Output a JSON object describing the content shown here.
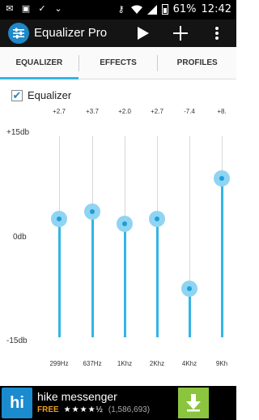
{
  "status_bar": {
    "battery": "61%",
    "time": "12:42",
    "left_icons": [
      "mail-icon",
      "image-icon",
      "shield-check-icon",
      "chevron-down-icon"
    ],
    "right_icons": [
      "key-icon",
      "wifi-icon",
      "signal-icon",
      "battery-icon"
    ]
  },
  "app_bar": {
    "title": "Equalizer Pro",
    "actions": [
      "play-icon",
      "add-icon",
      "overflow-menu-icon"
    ]
  },
  "tabs": [
    {
      "label": "EQUALIZER",
      "active": true
    },
    {
      "label": "EFFECTS",
      "active": false
    },
    {
      "label": "PROFILES",
      "active": false
    }
  ],
  "equalizer": {
    "toggle_label": "Equalizer",
    "enabled": true,
    "db_max_label": "+15db",
    "db_mid_label": "0db",
    "db_min_label": "-15db",
    "range": [
      -15,
      15
    ],
    "bands": [
      {
        "freq": "299Hz",
        "value_label": "+2.7",
        "value": 2.7
      },
      {
        "freq": "637Hz",
        "value_label": "+3.7",
        "value": 3.7
      },
      {
        "freq": "1Khz",
        "value_label": "+2.0",
        "value": 2.0
      },
      {
        "freq": "2Khz",
        "value_label": "+2.7",
        "value": 2.7
      },
      {
        "freq": "4Khz",
        "value_label": "-7.4",
        "value": -7.4
      },
      {
        "freq": "9Kh",
        "value_label": "+8.",
        "value": 8.6
      }
    ]
  },
  "ad": {
    "logo_text": "hi",
    "name": "hike messenger",
    "price": "FREE",
    "stars": "★★★★½",
    "rating_count": "(1,586,693)"
  },
  "colors": {
    "accent": "#33b5e5",
    "thumb": "#8fd4f2",
    "app_bar": "#141414",
    "ad_download": "#8bc53f"
  }
}
